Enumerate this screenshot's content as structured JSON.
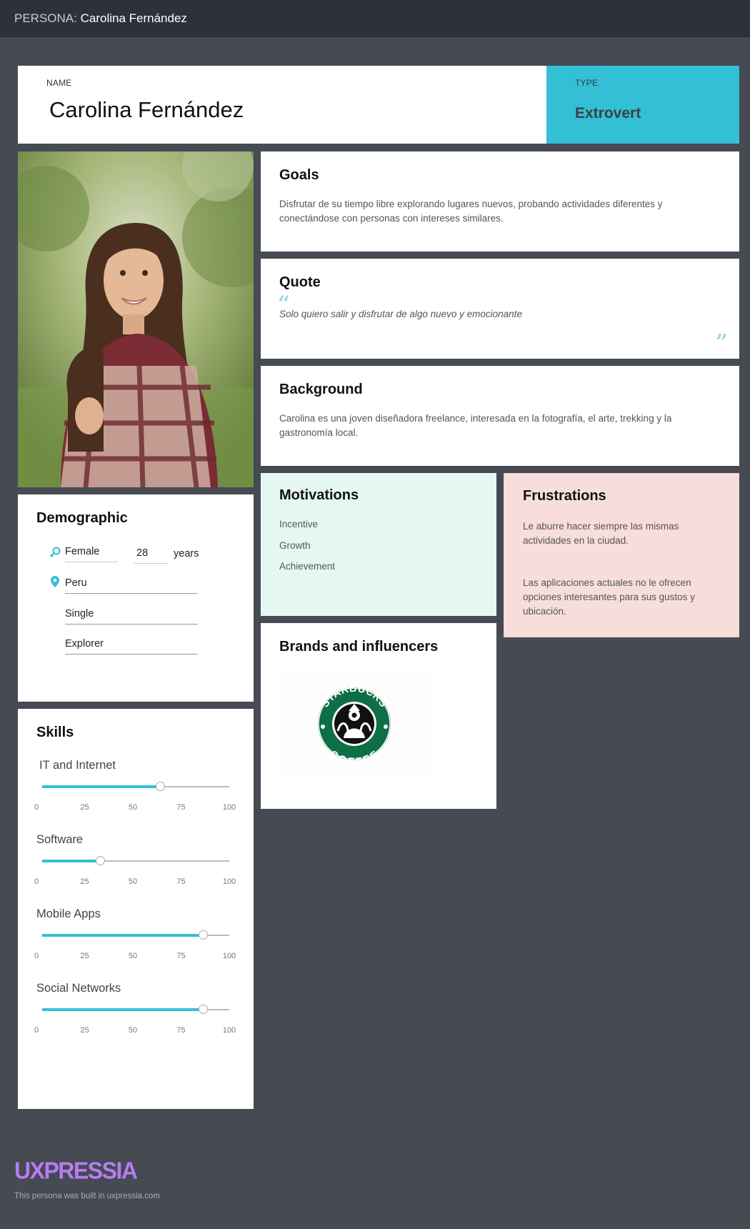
{
  "header": {
    "prefix": "PERSONA:",
    "title": "Carolina Fernández"
  },
  "name_card": {
    "label": "NAME",
    "name": "Carolina Fernández"
  },
  "type_card": {
    "label": "TYPE",
    "value": "Extrovert"
  },
  "goals": {
    "title": "Goals",
    "text": "Disfrutar de su tiempo libre explorando lugares nuevos, probando actividades diferentes y conectándose con personas con intereses similares."
  },
  "quote": {
    "title": "Quote",
    "text": "Solo quiero salir y disfrutar de algo nuevo y emocionante"
  },
  "background": {
    "title": "Background",
    "text": "Carolina es una joven diseñadora freelance, interesada en la fotografía, el arte, trekking y la gastronomía local."
  },
  "motivations": {
    "title": "Motivations",
    "items": [
      "Incentive",
      "Growth",
      "Achievement"
    ]
  },
  "frustrations": {
    "title": "Frustrations",
    "items": [
      "Le aburre hacer siempre las mismas actividades en la ciudad.",
      "Las aplicaciones actuales no le ofrecen opciones interesantes para sus gustos y ubicación."
    ]
  },
  "brands": {
    "title": "Brands and influencers",
    "logo_top": "STARBUCKS",
    "logo_bottom": "COFFEE"
  },
  "demographic": {
    "title": "Demographic",
    "gender": "Female",
    "age": "28",
    "age_unit": "years",
    "location": "Peru",
    "status": "Single",
    "archetype": "Explorer"
  },
  "skills": {
    "title": "Skills",
    "tick_labels": [
      "0",
      "25",
      "50",
      "75",
      "100"
    ],
    "items": [
      {
        "name": "IT and Internet",
        "value": 63
      },
      {
        "name": "Software",
        "value": 31
      },
      {
        "name": "Mobile Apps",
        "value": 86
      },
      {
        "name": "Social Networks",
        "value": 86
      }
    ]
  },
  "footer": {
    "brand": "UXPRESSIA",
    "text": "This persona was built in uxpressia.com"
  },
  "colors": {
    "accent": "#33bfd5",
    "motivations_bg": "#e6f7f2",
    "frustrations_bg": "#f8dedb",
    "brand": "#b77cf0"
  }
}
